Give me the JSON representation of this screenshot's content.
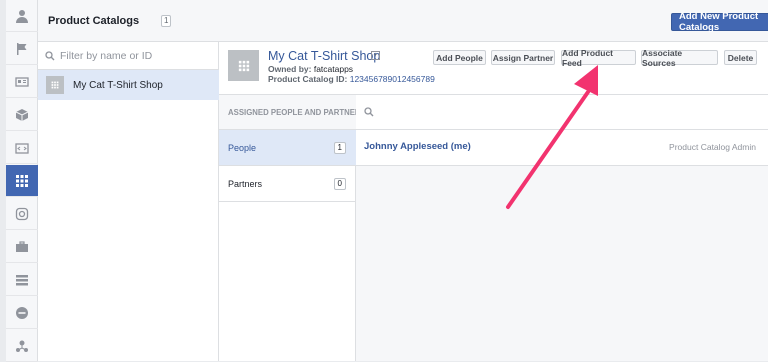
{
  "app": {
    "page_title": "Product Catalogs",
    "catalog_count": "1",
    "add_new_label": "Add New Product Catalogs"
  },
  "sidebar_rail": {
    "icons": [
      "person-icon",
      "flag-icon",
      "id-card-icon",
      "box-icon",
      "tag-icon",
      "grid-icon",
      "instagram-icon",
      "briefcase-icon",
      "stack-icon",
      "block-icon",
      "network-icon"
    ],
    "active_index": 5
  },
  "catalog_list": {
    "filter_placeholder": "Filter by name or ID",
    "items": [
      {
        "name": "My Cat T-Shirt Shop"
      }
    ]
  },
  "detail": {
    "name": "My Cat T-Shirt Shop",
    "owned_label": "Owned by:",
    "owner": "fatcatapps",
    "catalog_id_label": "Product Catalog ID:",
    "catalog_id": "123456789012456789",
    "actions": [
      "Add People",
      "Assign Partner",
      "Add Product Feed",
      "Associate Sources",
      "Delete"
    ]
  },
  "assigned": {
    "header": "ASSIGNED PEOPLE AND PARTNERS",
    "rows": [
      {
        "label": "People",
        "count": "1"
      },
      {
        "label": "Partners",
        "count": "0"
      }
    ],
    "people": [
      {
        "name": "Johnny Appleseed (me)",
        "role": "Product Catalog Admin"
      }
    ]
  },
  "colors": {
    "accent": "#4267b2",
    "link": "#365899",
    "selected_row": "#dfe8f7",
    "annotation_arrow": "#f2336f"
  }
}
